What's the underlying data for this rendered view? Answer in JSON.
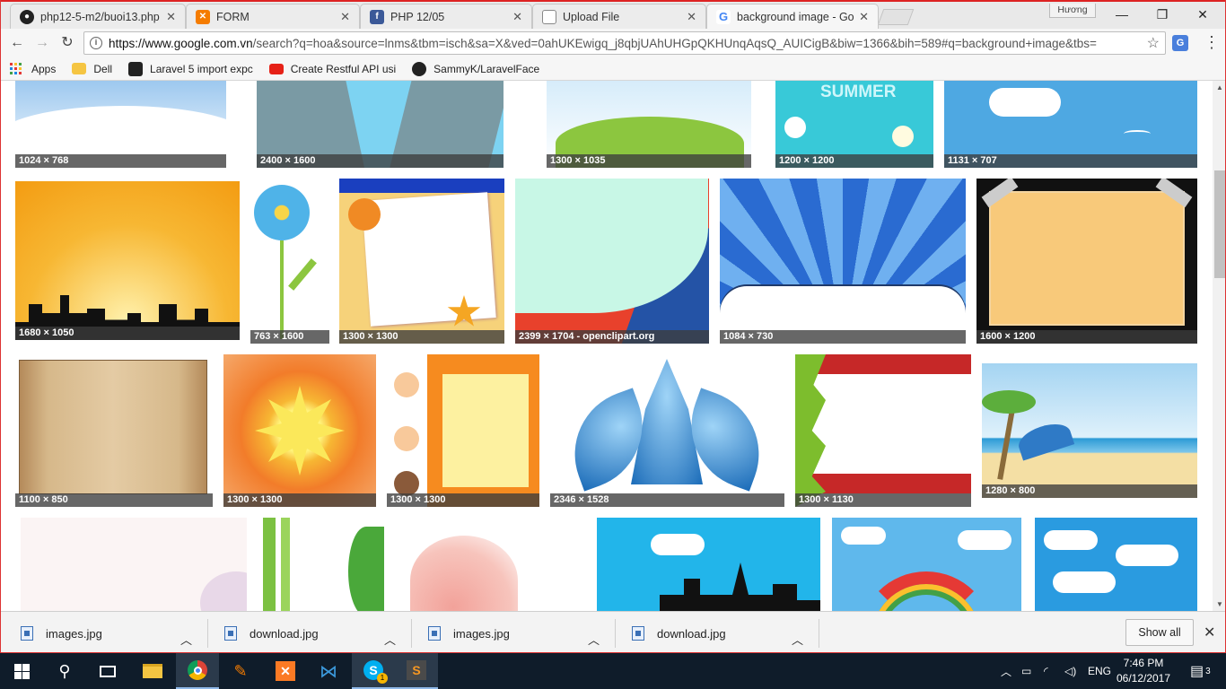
{
  "browser": {
    "tabs": [
      {
        "label": "php12-5-m2/buoi13.php",
        "icon": "github-icon",
        "active": false
      },
      {
        "label": "FORM",
        "icon": "xampp-icon",
        "active": false
      },
      {
        "label": "PHP 12/05",
        "icon": "facebook-icon",
        "active": false
      },
      {
        "label": "Upload File",
        "icon": "page-icon",
        "active": false
      },
      {
        "label": "background image - Goo",
        "icon": "google-icon",
        "active": true
      }
    ],
    "profile_name": "Hương",
    "url_host": "https://www.google.com.vn",
    "url_rest": "/search?q=hoa&source=lnms&tbm=isch&sa=X&ved=0ahUKEwigq_j8qbjUAhUHGpQKHUnqAqsQ_AUICigB&biw=1366&bih=589#q=background+image&tbs=",
    "bookmarks": [
      {
        "label": "Apps",
        "icon": "apps-grid-icon"
      },
      {
        "label": "Dell",
        "icon": "folder-icon"
      },
      {
        "label": "Laravel 5 import expc",
        "icon": "laravel-icon"
      },
      {
        "label": "Create Restful API usi",
        "icon": "youtube-icon"
      },
      {
        "label": "SammyK/LaravelFace",
        "icon": "github-icon"
      }
    ]
  },
  "results": {
    "rows": [
      [
        {
          "dims": "1024 × 768",
          "theme": "snow"
        },
        {
          "dims": "2400 × 1600",
          "theme": "buildings"
        },
        {
          "dims": "1300 × 1035",
          "theme": "hill"
        },
        {
          "dims": "1200 × 1200",
          "theme": "summer"
        },
        {
          "dims": "1131 × 707",
          "theme": "sky"
        }
      ],
      [
        {
          "dims": "1680 × 1050",
          "theme": "sunset-city"
        },
        {
          "dims": "763 × 1600",
          "theme": "flower"
        },
        {
          "dims": "1300 × 1300",
          "theme": "crab"
        },
        {
          "dims": "2399 × 1704 - openclipart.org",
          "theme": "mint"
        },
        {
          "dims": "1084 × 730",
          "theme": "rays"
        },
        {
          "dims": "1600 × 1200",
          "theme": "frame"
        }
      ],
      [
        {
          "dims": "1100 × 850",
          "theme": "scroll"
        },
        {
          "dims": "1300 × 1300",
          "theme": "sun"
        },
        {
          "dims": "1300 × 1300",
          "theme": "kids"
        },
        {
          "dims": "2346 × 1528",
          "theme": "lotus"
        },
        {
          "dims": "1300 × 1130",
          "theme": "xmas"
        },
        {
          "dims": "1280 × 800",
          "theme": "beach"
        }
      ],
      [
        {
          "theme": "pink"
        },
        {
          "theme": "bamboo"
        },
        {
          "theme": "petal"
        },
        {
          "theme": "city-sky"
        },
        {
          "theme": "rainbow"
        },
        {
          "theme": "clouds"
        }
      ]
    ],
    "summer_text": "SUMMER"
  },
  "downloads": {
    "items": [
      "images.jpg",
      "download.jpg",
      "images.jpg",
      "download.jpg"
    ],
    "show_all": "Show all"
  },
  "taskbar": {
    "language": "ENG",
    "time": "7:46 PM",
    "date": "06/12/2017",
    "notifications": "3",
    "skype_badge": "1"
  }
}
